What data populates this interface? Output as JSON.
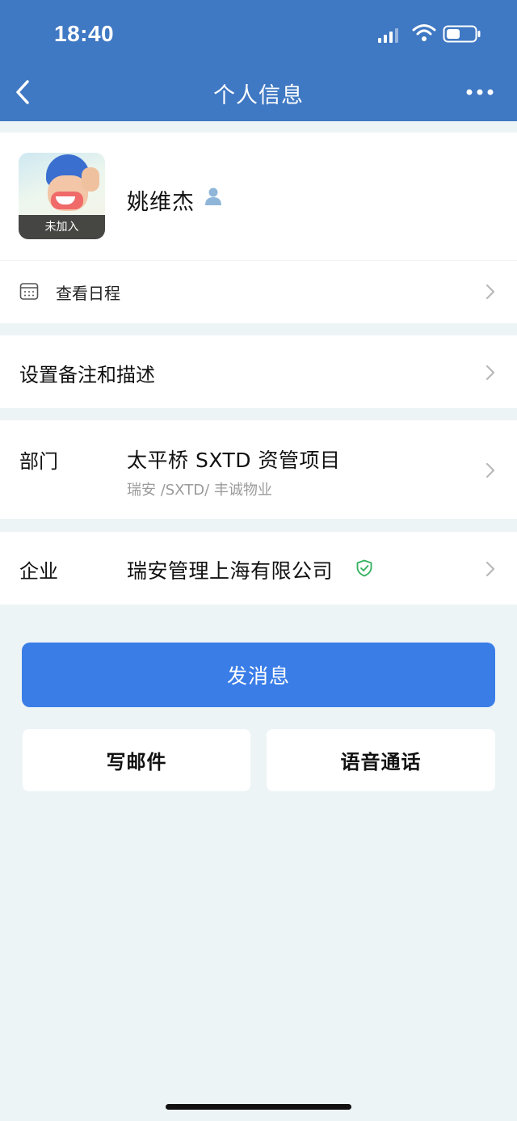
{
  "status_bar": {
    "time": "18:40",
    "icons": [
      "signal-icon",
      "wifi-icon",
      "battery-icon"
    ]
  },
  "nav": {
    "title": "个人信息",
    "back_icon": "chevron-left-icon",
    "more_icon": "more-icon"
  },
  "profile": {
    "name": "姚维杰",
    "avatar_badge": "未加入",
    "person_icon": "person-icon",
    "schedule_label": "查看日程"
  },
  "note_row": {
    "label": "设置备注和描述"
  },
  "department": {
    "label": "部门",
    "value": "太平桥 SXTD 资管项目",
    "sub": "瑞安 /SXTD/ 丰诚物业"
  },
  "company": {
    "label": "企业",
    "value": "瑞安管理上海有限公司",
    "verified_icon": "verified-shield-icon"
  },
  "actions": {
    "send_message": "发消息",
    "write_email": "写邮件",
    "voice_call": "语音通话"
  },
  "colors": {
    "header": "#3f78c3",
    "primary_button": "#3a7de7",
    "page_background": "#edf4f6",
    "verified_green": "#32b05d"
  }
}
